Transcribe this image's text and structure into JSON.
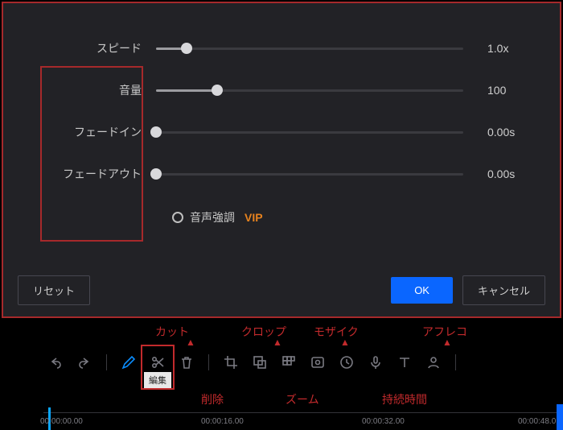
{
  "panel": {
    "speed": {
      "label": "スピード",
      "value": "1.0x",
      "pct": 10
    },
    "volume": {
      "label": "音量",
      "value": "100",
      "pct": 20
    },
    "fadein": {
      "label": "フェードイン",
      "value": "0.00s",
      "pct": 0
    },
    "fadeout": {
      "label": "フェードアウト",
      "value": "0.00s",
      "pct": 0
    },
    "voice_emph": "音声強調",
    "vip": "VIP",
    "reset": "リセット",
    "ok": "OK",
    "cancel": "キャンセル"
  },
  "annotations": {
    "cut": "カット",
    "crop": "クロップ",
    "mosaic": "モザイク",
    "afreco": "アフレコ",
    "delete": "削除",
    "zoom": "ズーム",
    "duration": "持続時間",
    "edit": "編集"
  },
  "timeline": {
    "t0": "00:00:00.00",
    "t1": "00:00:16.00",
    "t2": "00:00:32.00",
    "t3": "00:00:48.0"
  }
}
